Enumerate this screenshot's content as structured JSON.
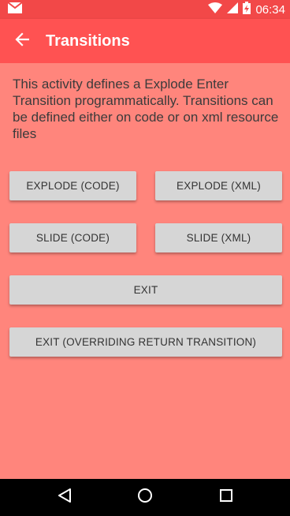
{
  "colors": {
    "status_bar": "#f24848",
    "app_bar": "#ff5252",
    "background": "#ff857c",
    "button": "#d6d6d6",
    "button_text": "#333333",
    "nav_bar": "#000000"
  },
  "status_bar": {
    "time": "06:34",
    "icons": [
      "gmail-icon",
      "wifi-icon",
      "signal-icon",
      "battery-charging-icon"
    ]
  },
  "app_bar": {
    "back_icon": "arrow-back-icon",
    "title": "Transitions"
  },
  "main": {
    "description": "This activity defines a Explode Enter Transition programmatically. Transitions can be defined either on code or on xml resource files",
    "buttons": {
      "explode_code": "EXPLODE (CODE)",
      "explode_xml": "EXPLODE (XML)",
      "slide_code": "SLIDE (CODE)",
      "slide_xml": "SLIDE (XML)",
      "exit": "EXIT",
      "exit_override": "EXIT (OVERRIDING RETURN TRANSITION)"
    }
  },
  "nav_bar": {
    "icons": [
      "back-triangle-icon",
      "home-circle-icon",
      "recents-square-icon"
    ]
  }
}
